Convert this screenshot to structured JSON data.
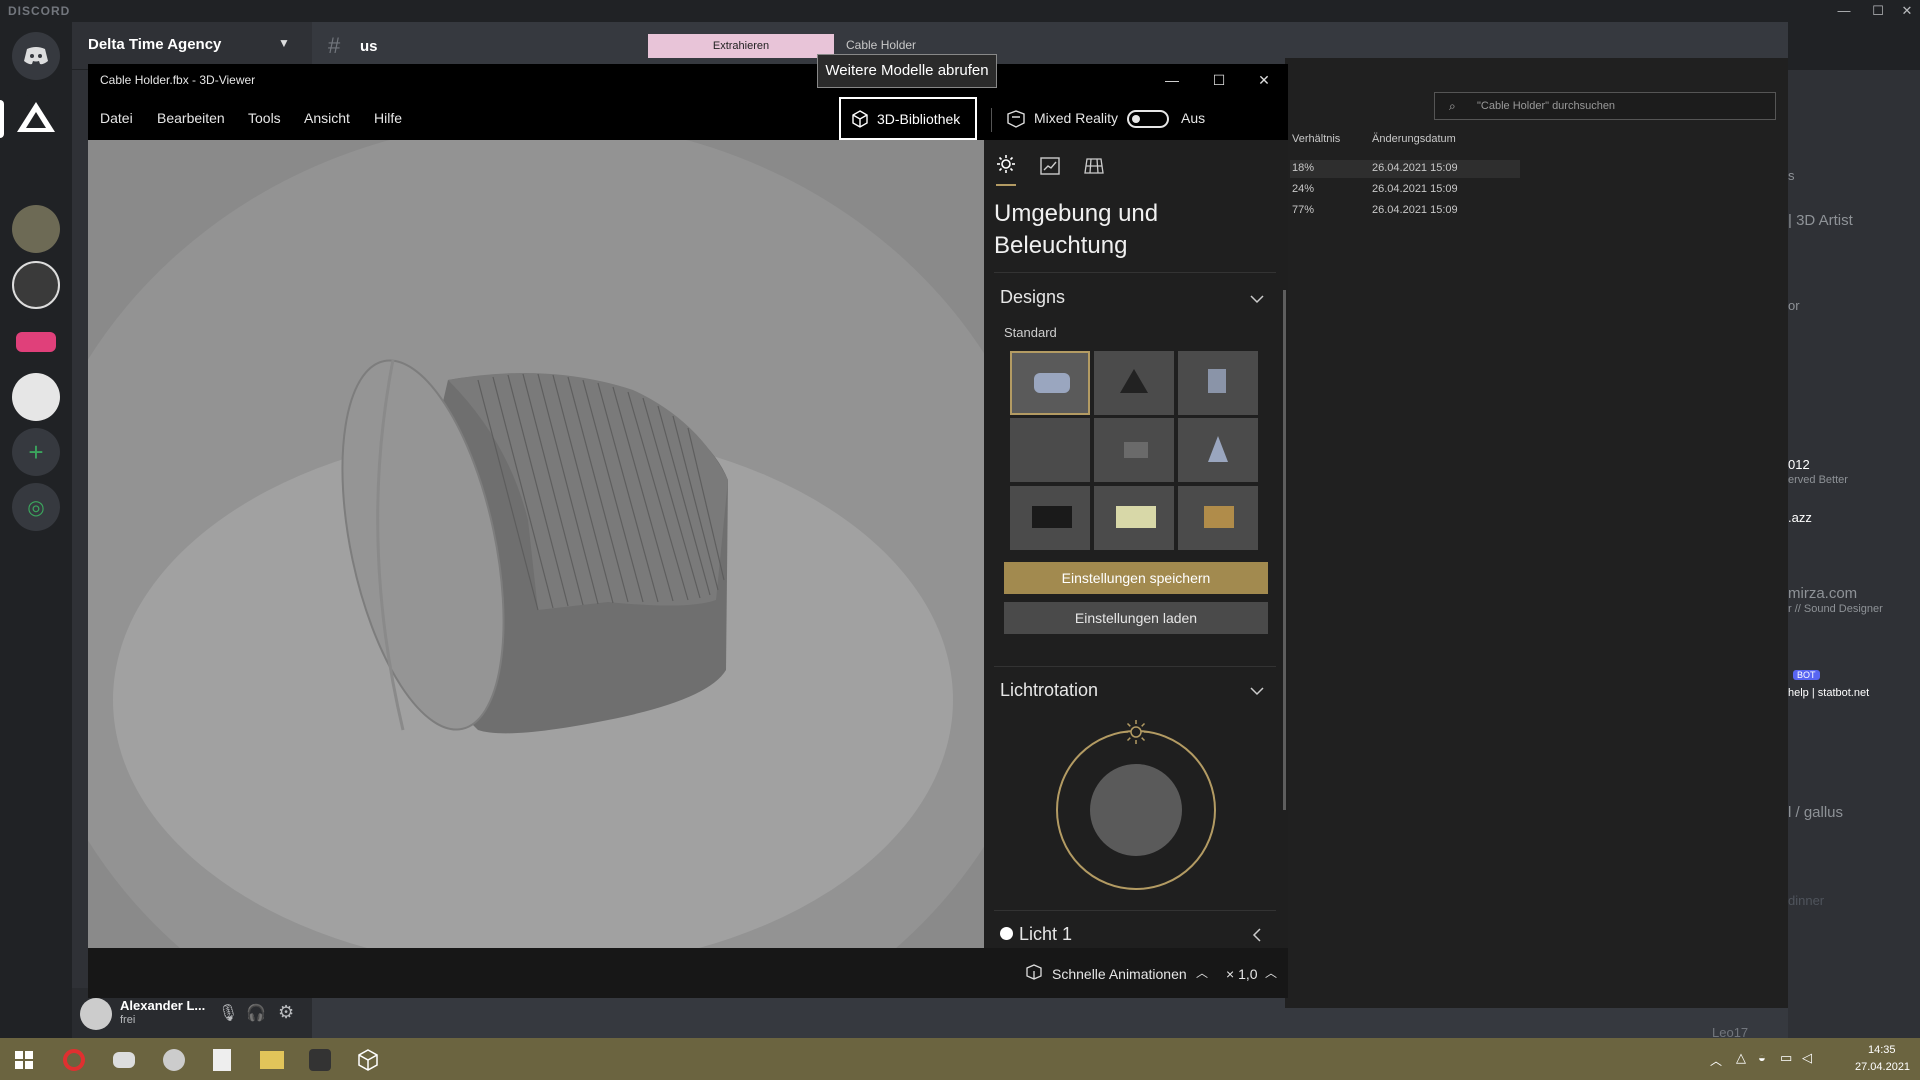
{
  "discord": {
    "app_name": "DISCORD",
    "server_name": "Delta Time Agency",
    "channel_name": "us",
    "user": {
      "name": "Alexander L...",
      "status": "frei"
    },
    "members": [
      "s",
      "| 3D Artist",
      "or",
      "012",
      "erved Better",
      ".azz",
      "mirza.com",
      "r // Sound Designer",
      "BOT",
      "help | statbot.net",
      "l / gallus",
      "dinner",
      "Leo17"
    ]
  },
  "explorer": {
    "tab_extract": "Extrahieren",
    "tab_name": "Cable Holder",
    "search_placeholder": "\"Cable Holder\" durchsuchen",
    "columns": [
      "Verhältnis",
      "Änderungsdatum"
    ],
    "rows": [
      {
        "ratio": "18%",
        "date": "26.04.2021 15:09"
      },
      {
        "ratio": "24%",
        "date": "26.04.2021 15:09"
      },
      {
        "ratio": "77%",
        "date": "26.04.2021 15:09"
      }
    ]
  },
  "viewer": {
    "title": "Cable Holder.fbx - 3D-Viewer",
    "menu": [
      "Datei",
      "Bearbeiten",
      "Tools",
      "Ansicht",
      "Hilfe"
    ],
    "library_button": "3D-Bibliothek",
    "tooltip": "Weitere Modelle abrufen",
    "mixed_reality": {
      "label": "Mixed Reality",
      "state": "Aus"
    },
    "panel": {
      "title": "Umgebung und Beleuchtung",
      "designs_heading": "Designs",
      "standard_label": "Standard",
      "save_button": "Einstellungen speichern",
      "load_button": "Einstellungen laden",
      "light_rotation_heading": "Lichtrotation",
      "light1_label": "Licht 1"
    },
    "bottom": {
      "animations_label": "Schnelle Animationen",
      "speed": "× 1,0"
    }
  },
  "taskbar": {
    "time": "14:35",
    "date": "27.04.2021"
  },
  "colors": {
    "accent_gold": "#a28a4f",
    "taskbar": "#6b6440",
    "viewport_bg": "#8a8a8a",
    "tab_pink": "#e8c4d8"
  }
}
